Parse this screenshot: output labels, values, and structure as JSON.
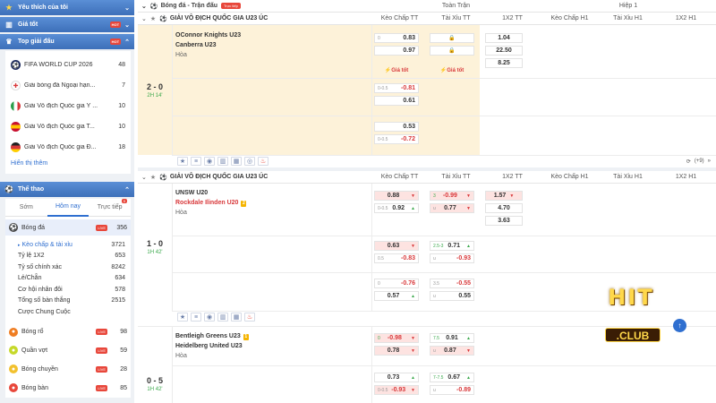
{
  "sidebar": {
    "favorites": {
      "label": "Yêu thích của tôi"
    },
    "good_price": {
      "label": "Giá tốt",
      "hot": "HOT"
    },
    "top_leagues": {
      "label": "Top giải đấu",
      "hot": "HOT",
      "items": [
        {
          "name": "FIFA WORLD CUP 2026",
          "count": "48"
        },
        {
          "name": "Giải bóng đá Ngoại hạn...",
          "count": "7"
        },
        {
          "name": "Giải Vô địch Quốc gia Ý ...",
          "count": "10"
        },
        {
          "name": "Giải Vô địch Quốc gia T...",
          "count": "10"
        },
        {
          "name": "Giải Vô địch Quốc gia Đ...",
          "count": "18"
        }
      ],
      "show_more": "Hiển thị thêm"
    },
    "sports": {
      "label": "Thể thao",
      "tabs": [
        {
          "label": "Sớm"
        },
        {
          "label": "Hôm nay"
        },
        {
          "label": "Trực tiếp",
          "badge": "5"
        }
      ],
      "football": {
        "name": "Bóng đá",
        "live": "LIVE",
        "count": "356"
      },
      "sub_items": [
        {
          "name": "Kèo chấp & tài xỉu",
          "count": "3721"
        },
        {
          "name": "Tỷ lệ 1X2",
          "count": "653"
        },
        {
          "name": "Tỷ số chính xác",
          "count": "8242"
        },
        {
          "name": "Lẻ/Chẵn",
          "count": "634"
        },
        {
          "name": "Cơ hội nhân đôi",
          "count": "578"
        },
        {
          "name": "Tổng số bàn thắng",
          "count": "2515"
        },
        {
          "name": "Cược Chung Cuộc",
          "count": ""
        }
      ],
      "others": [
        {
          "name": "Bóng rổ",
          "live": "LIVE",
          "count": "98"
        },
        {
          "name": "Quần vợt",
          "live": "LIVE",
          "count": "59"
        },
        {
          "name": "Bóng chuyền",
          "live": "LIVE",
          "count": "28"
        },
        {
          "name": "Bóng bàn",
          "live": "LIVE",
          "count": "85"
        }
      ]
    }
  },
  "main": {
    "header_title": "Bóng đá - Trận đấu",
    "live_badge": "Trực tiếp",
    "full_match": "Toàn Trận",
    "half1": "Hiệp 1",
    "columns": {
      "handicap": "Kèo Chấp TT",
      "overunder": "Tài Xỉu TT",
      "x12": "1X2 TT",
      "handicap_h1": "Kèo Chấp H1",
      "overunder_h1": "Tài Xỉu H1",
      "x12_h1": "1X2 H1"
    },
    "league": "GIẢI VÔ ĐỊCH QUỐC GIA U23 ÚC",
    "gia_tot": "Giá tốt",
    "more_markets": "(+9)",
    "matches": [
      {
        "home": "OConnor Knights U23",
        "away": "Canberra U23",
        "draw": "Hòa",
        "score": "2 - 0",
        "time": "2H 14'",
        "rows": [
          {
            "hdp_line": "0",
            "hdp_home": "0.83",
            "hdp_away": "0.97",
            "x12": [
              "1.04",
              "22.50",
              "8.25"
            ]
          },
          {
            "hdp_line": "0-0.5",
            "hdp_home": "-0.81",
            "hdp_away": "0.61"
          },
          {
            "hdp_line": "",
            "hdp_home": "0.53",
            "hdp_away": "-0.72"
          }
        ]
      },
      {
        "home": "UNSW U20",
        "away": "Rockdale Ilinden U20",
        "away_cards": "2",
        "draw": "Hòa",
        "score": "1 - 0",
        "time": "1H 42'",
        "rows": [
          {
            "hdp_line": "0-0.5",
            "hdp_home": "0.88",
            "hdp_away": "0.92",
            "ou_line": "3",
            "ou_u": "u",
            "ou_over": "-0.99",
            "ou_under": "0.77",
            "x12": [
              "1.57",
              "4.70",
              "3.63"
            ]
          },
          {
            "hdp_line": "0.5",
            "hdp_home": "0.63",
            "hdp_away": "-0.83",
            "ou_line": "2.5-3",
            "ou_u": "u",
            "ou_over": "0.71",
            "ou_under": "-0.93"
          },
          {
            "hdp_line": "0",
            "hdp_home": "-0.76",
            "hdp_away": "0.57",
            "ou_line": "3.5",
            "ou_u": "u",
            "ou_over": "-0.55",
            "ou_under": "0.55"
          }
        ]
      },
      {
        "home": "Bentleigh Greens U23",
        "home_cards": "1",
        "away": "Heidelberg United U23",
        "draw": "Hòa",
        "score": "0 - 5",
        "time": "1H 42'",
        "rows": [
          {
            "hdp_line": "0",
            "hdp_home": "-0.98",
            "hdp_away": "0.78",
            "ou_line": "7.5",
            "ou_u": "u",
            "ou_over": "0.91",
            "ou_under": "0.87"
          },
          {
            "hdp_line": "0-0.5",
            "hdp_home": "0.73",
            "hdp_away": "-0.93",
            "ou_line": "7-7.5",
            "ou_u": "u",
            "ou_over": "0.67",
            "ou_under": "-0.89"
          }
        ]
      }
    ]
  },
  "logo": {
    "top": "HIT",
    "bottom": ".CLUB"
  },
  "colors": {
    "accent": "#2f6fd0",
    "header": "#3d6fb9",
    "highlight": "#fdf2d9",
    "negative": "#d8383a",
    "live": "#e8473b"
  }
}
